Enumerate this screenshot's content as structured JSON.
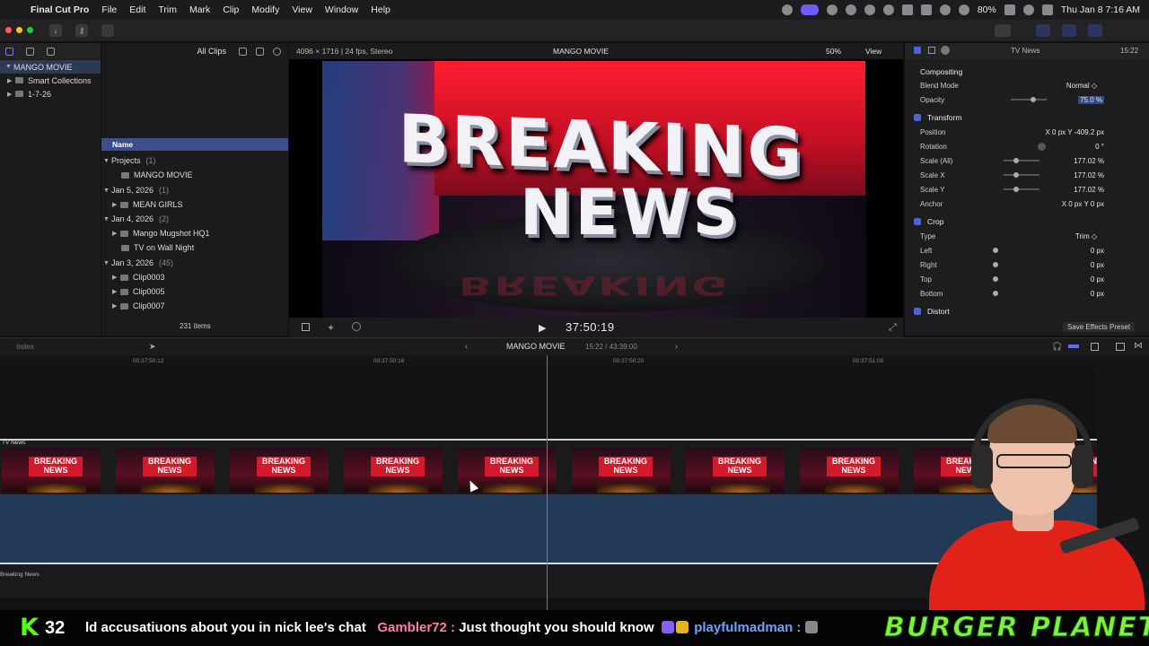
{
  "menubar": {
    "app": "Final Cut Pro",
    "items": [
      "File",
      "Edit",
      "Trim",
      "Mark",
      "Clip",
      "Modify",
      "View",
      "Window",
      "Help"
    ],
    "battery": "80%",
    "clock": "Thu Jan 8  7:16 AM"
  },
  "library": {
    "name": "MANGO MOVIE",
    "smart_collections": "Smart Collections",
    "event": "1-7-26"
  },
  "browser": {
    "filter": "All Clips",
    "column_name": "Name",
    "groups": [
      {
        "label": "Projects",
        "count": "(1)",
        "items": [
          "MANGO MOVIE"
        ]
      },
      {
        "label": "Jan 5, 2026",
        "count": "(1)",
        "items": [
          "MEAN GIRLS"
        ]
      },
      {
        "label": "Jan 4, 2026",
        "count": "(2)",
        "items": [
          "Mango Mugshot HQ1",
          "TV on Wall Night"
        ]
      },
      {
        "label": "Jan 3, 2026",
        "count": "(45)",
        "items": [
          "Clip0003",
          "Clip0005",
          "Clip0007"
        ]
      }
    ],
    "items_count": "231 items"
  },
  "viewer": {
    "format": "4096 × 1716 | 24 fps, Stereo",
    "title": "MANGO MOVIE",
    "zoom": "50%",
    "view_menu": "View",
    "frame_text_1": "BREAKING",
    "frame_text_2": "NEWS",
    "timecode": "37:50:19"
  },
  "inspector": {
    "clip_name": "TV News",
    "duration": "15:22",
    "sections": {
      "compositing": "Compositing",
      "transform": "Transform",
      "crop": "Crop",
      "distort": "Distort"
    },
    "rows": {
      "blend_mode": {
        "label": "Blend Mode",
        "value": "Normal ◇"
      },
      "opacity": {
        "label": "Opacity",
        "value": "75.0 %"
      },
      "position": {
        "label": "Position",
        "value": "X  0 px   Y  -409.2 px"
      },
      "rotation": {
        "label": "Rotation",
        "value": "0 °"
      },
      "scale_all": {
        "label": "Scale (All)",
        "value": "177.02 %"
      },
      "scale_x": {
        "label": "Scale X",
        "value": "177.02 %"
      },
      "scale_y": {
        "label": "Scale Y",
        "value": "177.02 %"
      },
      "anchor": {
        "label": "Anchor",
        "value": "X  0 px   Y  0 px"
      },
      "type": {
        "label": "Type",
        "value": "Trim ◇"
      },
      "left": {
        "label": "Left",
        "value": "0 px"
      },
      "right": {
        "label": "Right",
        "value": "0 px"
      },
      "top": {
        "label": "Top",
        "value": "0 px"
      },
      "bottom": {
        "label": "Bottom",
        "value": "0 px"
      }
    },
    "save_preset": "Save Effects Preset"
  },
  "timeline": {
    "index": "Index",
    "project": "MANGO MOVIE",
    "duration": "15:22 / 43:39:00",
    "ruler": [
      "00:37:50:12",
      "00:37:50:16",
      "00:37:50:20",
      "00:37:51:00"
    ],
    "clip_label": "TV News",
    "thumb_text": "BREAKING NEWS",
    "title_label": "Breaking News"
  },
  "stream": {
    "kick": "K",
    "count": "32",
    "ticker_1": "ld accusatiuons about you in nick lee's chat",
    "user_1": "Gambler72 :",
    "msg_1": "Just thought you should know",
    "user_2": "playfulmadman :",
    "brand": "BURGER PLANET"
  }
}
